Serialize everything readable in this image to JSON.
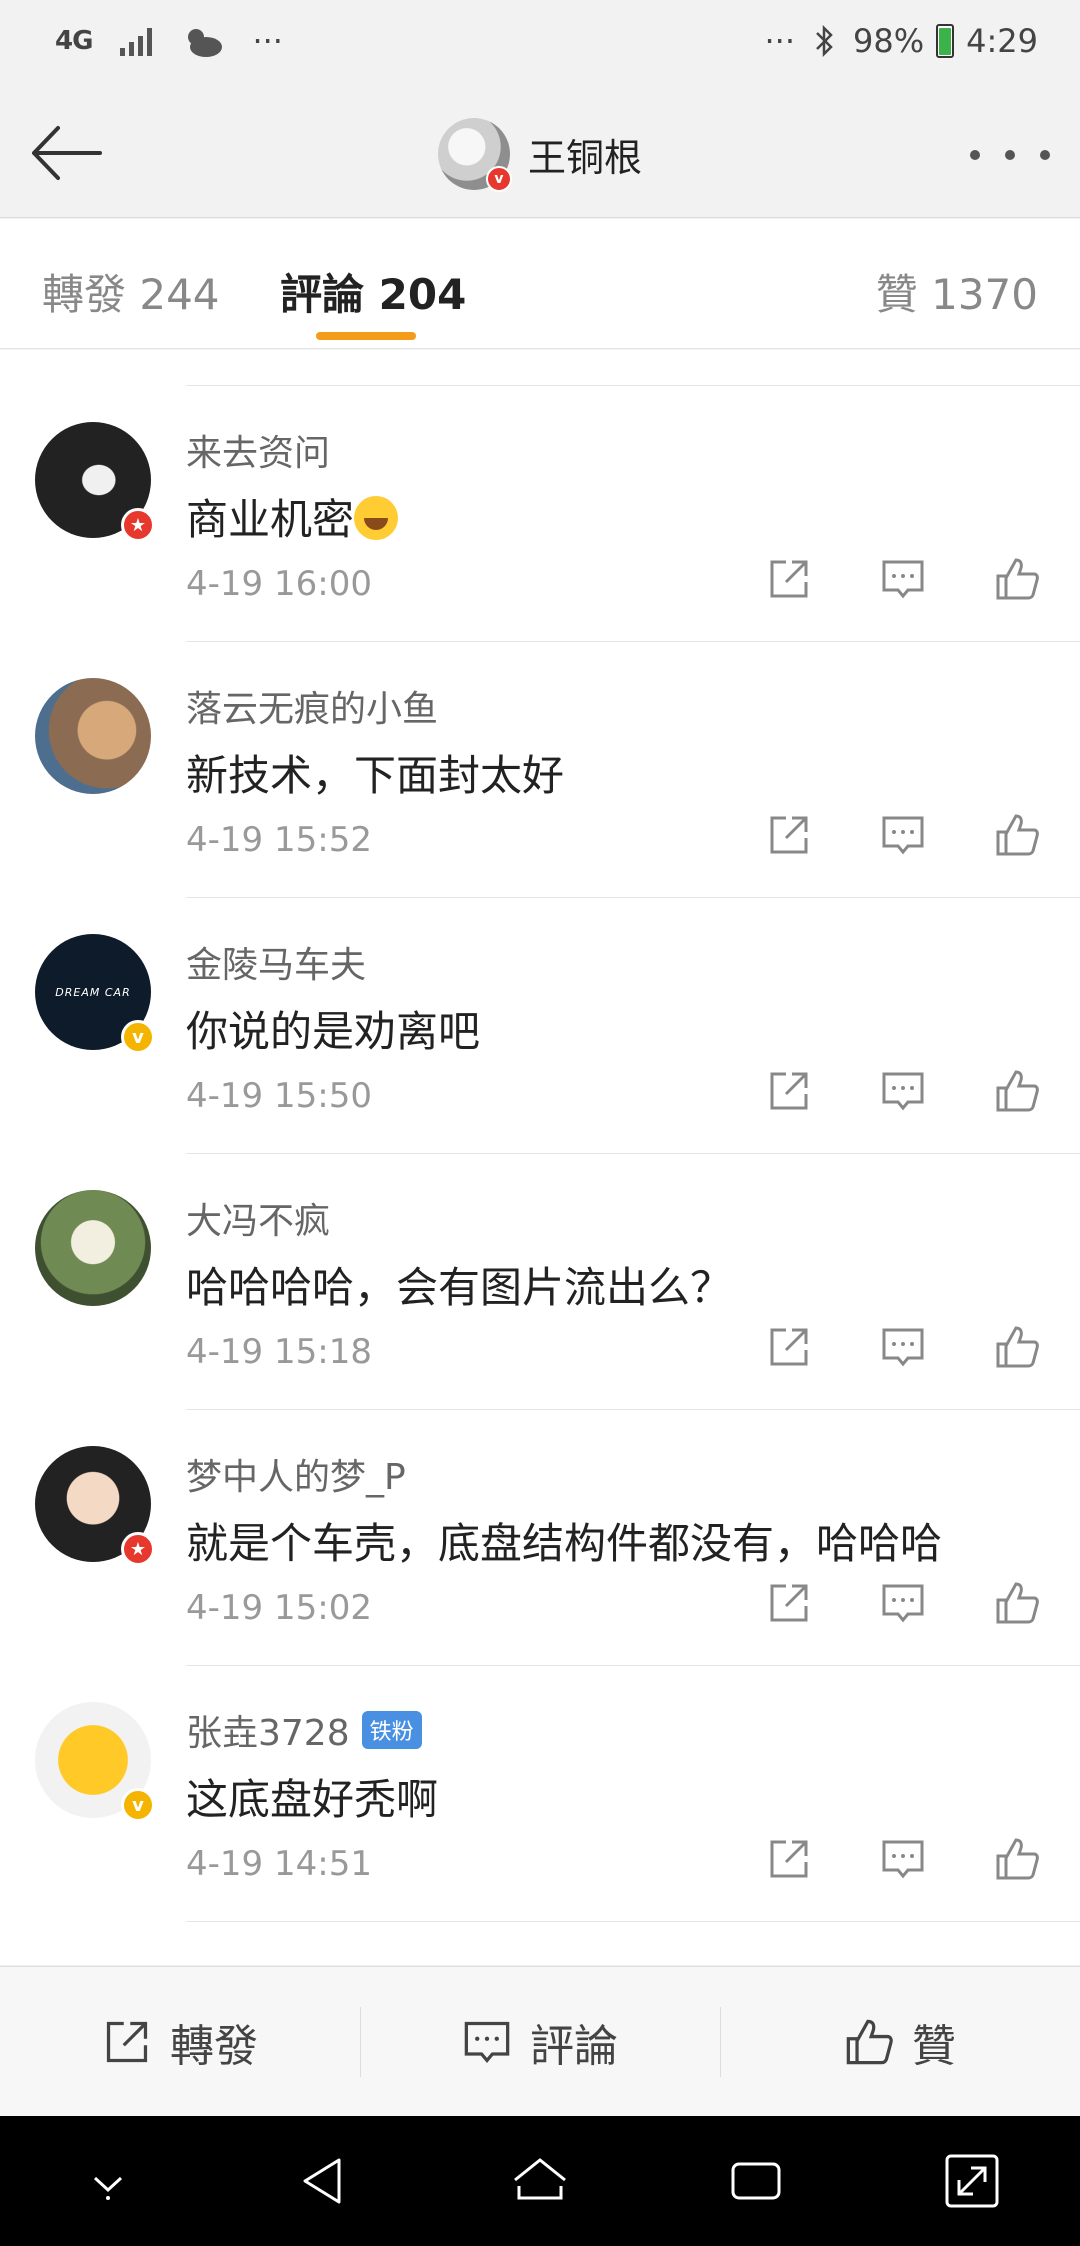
{
  "status_bar": {
    "network": "4G",
    "more_left": "···",
    "more_right": "···",
    "battery": "98%",
    "time": "4:29"
  },
  "header": {
    "title": "王铜根"
  },
  "tabs": [
    {
      "label": "轉發 244"
    },
    {
      "label": "評論 204"
    },
    {
      "label": "贊 1370"
    }
  ],
  "comments": [
    {
      "user": "来去资问",
      "content": "商业机密",
      "time": "4-19 16:00",
      "badge": "red"
    },
    {
      "user": "落云无痕的小鱼",
      "content": "新技术，下面封太好",
      "time": "4-19 15:52"
    },
    {
      "user": "金陵马车夫",
      "content": "你说的是劝离吧",
      "time": "4-19 15:50",
      "badge": "gold",
      "avatar_text": "DREAM CAR"
    },
    {
      "user": "大冯不疯",
      "content": "哈哈哈哈，会有图片流出么？",
      "time": "4-19 15:18"
    },
    {
      "user": "梦中人的梦_P",
      "content": "就是个车壳，底盘结构件都没有，哈哈哈",
      "time": "4-19 15:02",
      "badge": "red"
    },
    {
      "user": "张垚3728",
      "fan_badge": "铁粉",
      "content": "这底盘好秃啊",
      "time": "4-19 14:51",
      "badge": "gold"
    }
  ],
  "bottom_bar": {
    "repost": "轉發",
    "comment": "評論",
    "like": "贊"
  },
  "colors": {
    "accent": "#f39c1a",
    "verified_red": "#e6382d",
    "verified_gold": "#f4b400"
  }
}
